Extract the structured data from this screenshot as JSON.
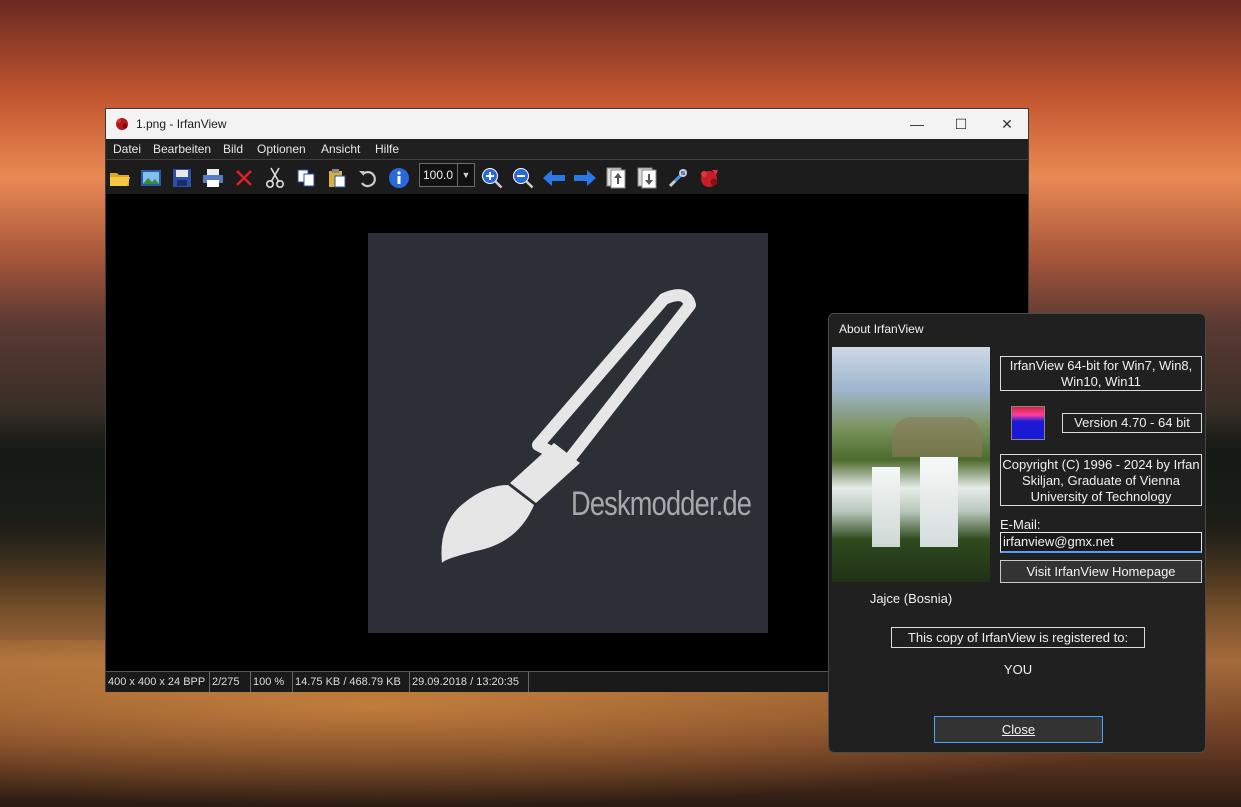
{
  "main_window": {
    "title": "1.png - IrfanView",
    "controls": {
      "minimize": "—",
      "maximize": "☐",
      "close": "✕"
    },
    "menu": [
      "Datei",
      "Bearbeiten",
      "Bild",
      "Optionen",
      "Ansicht",
      "Hilfe"
    ],
    "toolbar": {
      "zoom_value": "100.0",
      "buttons": [
        "open-icon",
        "thumbnails-icon",
        "save-icon",
        "print-icon",
        "delete-icon",
        "cut-icon",
        "copy-icon",
        "paste-icon",
        "undo-icon",
        "info-icon",
        "zoom-in-icon",
        "zoom-out-icon",
        "previous-icon",
        "next-icon",
        "first-page-icon",
        "last-page-icon",
        "settings-icon",
        "exit-icon"
      ]
    },
    "image": {
      "watermark": "Deskmodder.de"
    },
    "status": [
      "400 x 400 x 24 BPP",
      "2/275",
      "100 %",
      "14.75 KB / 468.79 KB",
      "29.09.2018 / 13:20:35"
    ]
  },
  "about_dialog": {
    "title": "About  IrfanView",
    "photo_caption": "Jajce (Bosnia)",
    "product": "IrfanView 64-bit for Win7, Win8, Win10, Win11",
    "version": "Version 4.70 - 64 bit",
    "copyright": "Copyright (C) 1996 - 2024 by Irfan Skiljan, Graduate of Vienna University of Technology",
    "email_label": "E-Mail:",
    "email_value": "irfanview@gmx.net",
    "homepage_button": "Visit IrfanView Homepage",
    "registered_label": "This copy of IrfanView is registered to:",
    "registered_to": "YOU",
    "close_button": "Close"
  }
}
